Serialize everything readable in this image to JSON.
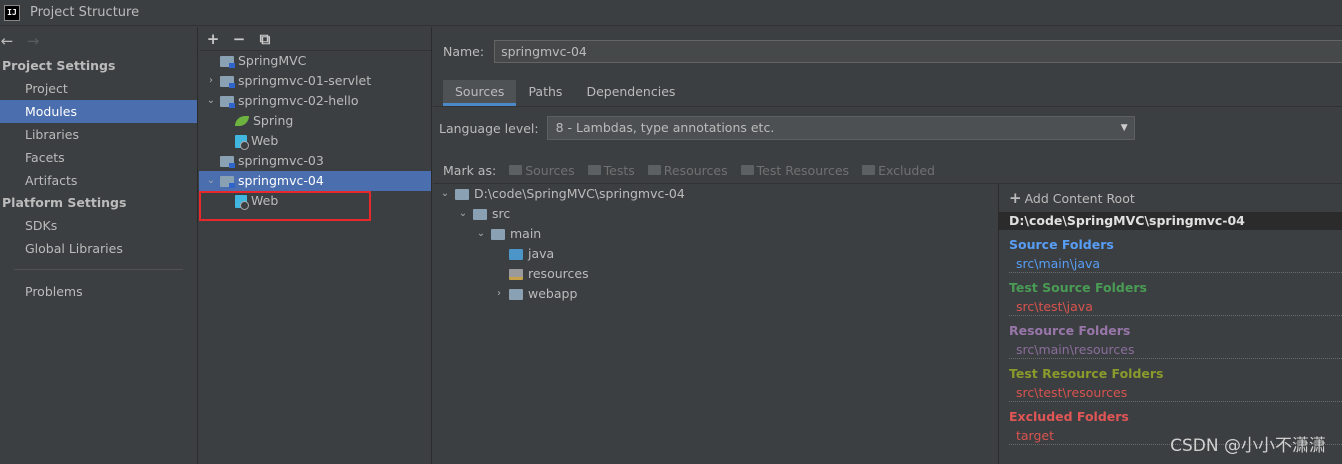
{
  "window": {
    "title": "Project Structure",
    "logo": "IJ"
  },
  "nav": {
    "back": "←",
    "forward": "→"
  },
  "settings": {
    "project_settings_header": "Project Settings",
    "project_items": [
      "Project",
      "Modules",
      "Libraries",
      "Facets",
      "Artifacts"
    ],
    "selected": "Modules",
    "platform_settings_header": "Platform Settings",
    "platform_items": [
      "SDKs",
      "Global Libraries"
    ],
    "problems": "Problems"
  },
  "module_toolbar": {
    "add": "+",
    "remove": "−",
    "copy": "⧉"
  },
  "module_tree": [
    {
      "label": "SpringMVC",
      "indent": 0,
      "arrow": "",
      "icon": "module"
    },
    {
      "label": "springmvc-01-servlet",
      "indent": 0,
      "arrow": "›",
      "icon": "module"
    },
    {
      "label": "springmvc-02-hello",
      "indent": 0,
      "arrow": "⌄",
      "icon": "module"
    },
    {
      "label": "Spring",
      "indent": 1,
      "arrow": "",
      "icon": "spring"
    },
    {
      "label": "Web",
      "indent": 1,
      "arrow": "",
      "icon": "web"
    },
    {
      "label": "springmvc-03",
      "indent": 0,
      "arrow": "",
      "icon": "module"
    },
    {
      "label": "springmvc-04",
      "indent": 0,
      "arrow": "⌄",
      "icon": "module",
      "selected": true
    },
    {
      "label": "Web",
      "indent": 1,
      "arrow": "",
      "icon": "web"
    }
  ],
  "main": {
    "name_label": "Name:",
    "name_value": "springmvc-04",
    "tabs": [
      "Sources",
      "Paths",
      "Dependencies"
    ],
    "active_tab": "Sources",
    "language_label": "Language level:",
    "language_value": "8 - Lambdas, type annotations etc.",
    "mark_as_label": "Mark as:",
    "mark_buttons": [
      "Sources",
      "Tests",
      "Resources",
      "Test Resources",
      "Excluded"
    ]
  },
  "folder_tree": [
    {
      "label": "D:\\code\\SpringMVC\\springmvc-04",
      "indent": 0,
      "arrow": "⌄",
      "kind": "plain"
    },
    {
      "label": "src",
      "indent": 1,
      "arrow": "⌄",
      "kind": "plain"
    },
    {
      "label": "main",
      "indent": 2,
      "arrow": "⌄",
      "kind": "plain"
    },
    {
      "label": "java",
      "indent": 3,
      "arrow": "",
      "kind": "src"
    },
    {
      "label": "resources",
      "indent": 3,
      "arrow": "",
      "kind": "res"
    },
    {
      "label": "webapp",
      "indent": 3,
      "arrow": "›",
      "kind": "plain"
    }
  ],
  "content_root": {
    "add_label": "Add Content Root",
    "root_path": "D:\\code\\SpringMVC\\springmvc-04",
    "groups": [
      {
        "title": "Source Folders",
        "path": "src\\main\\java"
      },
      {
        "title": "Test Source Folders",
        "path": "src\\test\\java"
      },
      {
        "title": "Resource Folders",
        "path": "src\\main\\resources"
      },
      {
        "title": "Test Resource Folders",
        "path": "src\\test\\resources"
      },
      {
        "title": "Excluded Folders",
        "path": "target"
      }
    ]
  },
  "watermark": "CSDN @小小不潇潇",
  "colors": {
    "selection": "#4b6eaf",
    "highlight_box": "#e8282b"
  }
}
